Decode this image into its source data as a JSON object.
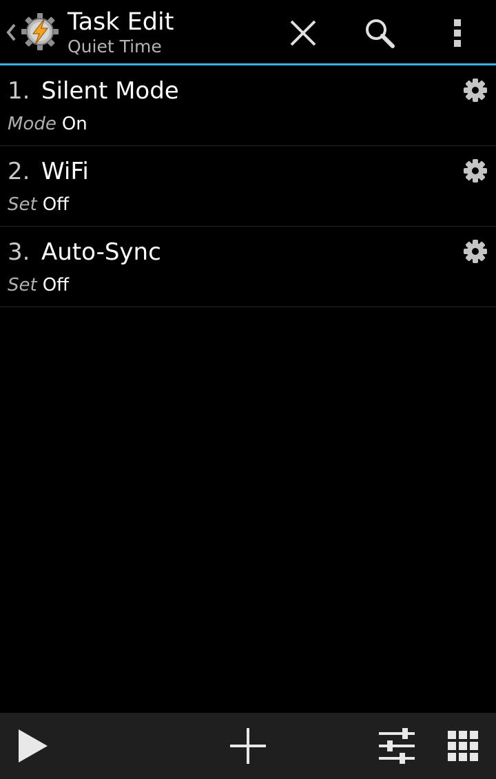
{
  "header": {
    "title": "Task Edit",
    "subtitle": "Quiet Time",
    "accent_color": "#33b5e5",
    "icons": [
      "chevron-left-icon",
      "tasker-app-icon",
      "close-icon",
      "search-icon",
      "overflow-menu-icon"
    ]
  },
  "actions": [
    {
      "number": "1.",
      "name": "Silent Mode",
      "param_label": "Mode",
      "param_value": "On"
    },
    {
      "number": "2.",
      "name": "WiFi",
      "param_label": "Set",
      "param_value": "Off"
    },
    {
      "number": "3.",
      "name": "Auto-Sync",
      "param_label": "Set",
      "param_value": "Off"
    }
  ],
  "bottom_bar": {
    "icons": [
      "play-icon",
      "add-icon",
      "sliders-icon",
      "grid-icon"
    ]
  }
}
